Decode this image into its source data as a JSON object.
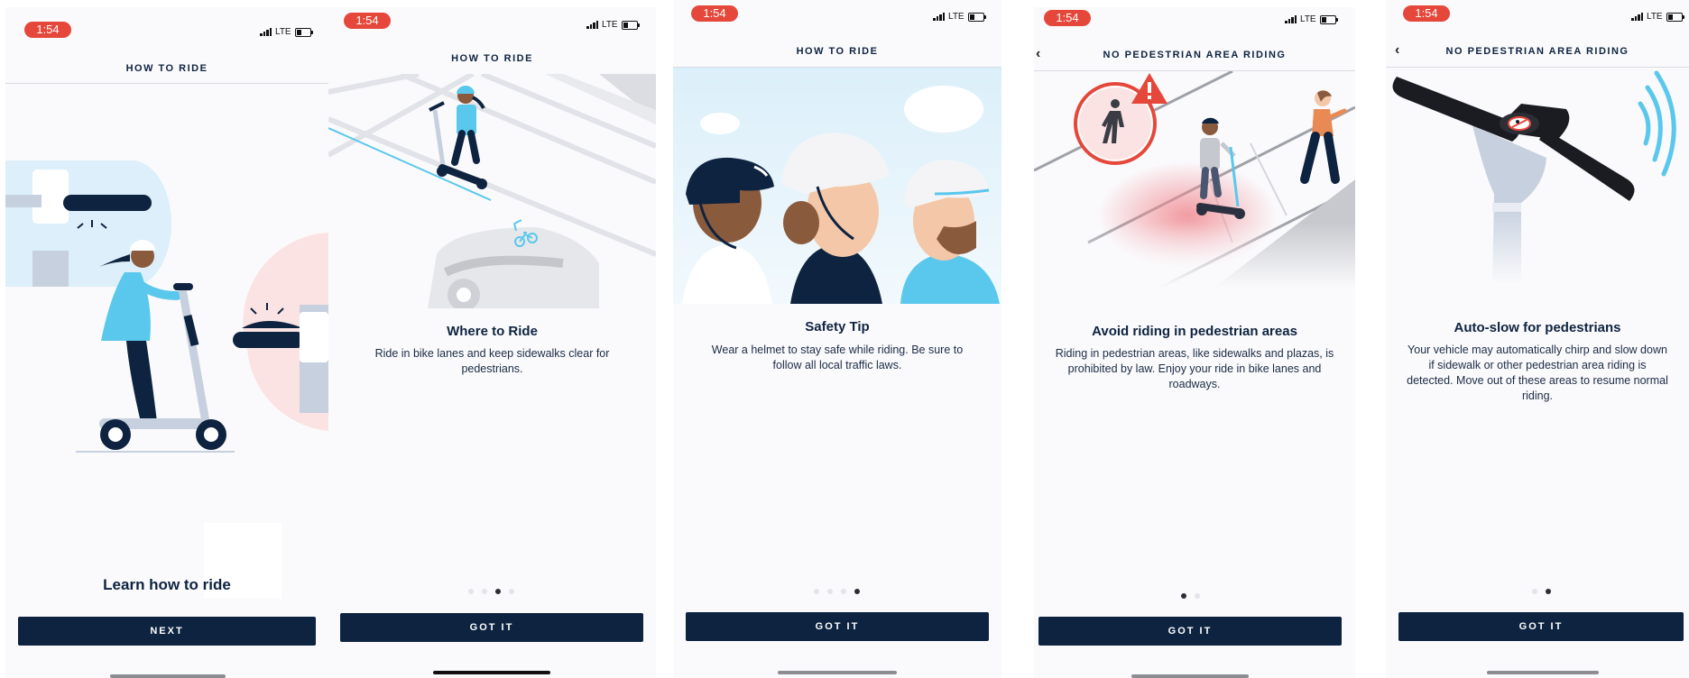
{
  "status": {
    "time": "1:54",
    "network": "LTE"
  },
  "screens": [
    {
      "header": "HOW TO RIDE",
      "title": "Learn how to ride",
      "button": "NEXT"
    },
    {
      "header": "HOW TO RIDE",
      "title": "Where to Ride",
      "body": "Ride in bike lanes and keep sidewalks clear for pedestrians.",
      "button": "GOT IT",
      "pager": {
        "count": 4,
        "active": 2
      }
    },
    {
      "header": "HOW TO RIDE",
      "title": "Safety Tip",
      "body": "Wear a helmet to stay safe while riding. Be sure to follow all local traffic laws.",
      "button": "GOT IT",
      "pager": {
        "count": 4,
        "active": 3
      }
    },
    {
      "header": "NO PEDESTRIAN AREA RIDING",
      "title": "Avoid riding in pedestrian areas",
      "body": "Riding in pedestrian areas, like sidewalks and plazas, is prohibited by law. Enjoy your ride in bike lanes and roadways.",
      "button": "GOT IT",
      "pager": {
        "count": 2,
        "active": 0
      }
    },
    {
      "header": "NO PEDESTRIAN AREA RIDING",
      "title": "Auto-slow for pedestrians",
      "body": "Your vehicle may automatically chirp and slow down if sidewalk or other pedestrian area riding is detected. Move out of these areas to resume normal riding.",
      "button": "GOT IT",
      "pager": {
        "count": 2,
        "active": 1
      }
    }
  ],
  "colors": {
    "button": "#0d2340",
    "time_pill": "#e5483b",
    "accent_blue": "#5ac8ec",
    "warning_red": "#e5483b"
  },
  "icons": [
    "back-arrow-icon",
    "signal-bars-icon",
    "battery-icon",
    "pedestrian-icon",
    "warning-icon",
    "no-pedestrian-icon",
    "bike-icon"
  ]
}
